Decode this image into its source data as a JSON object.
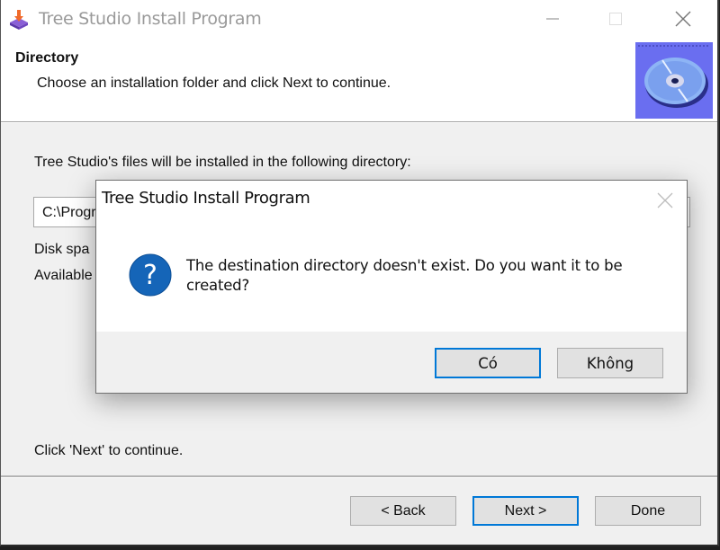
{
  "window": {
    "title": "Tree Studio Install Program",
    "icons": {
      "app": "install-box-icon",
      "minimize": "minimize-icon",
      "maximize": "maximize-icon",
      "close": "close-icon"
    }
  },
  "header": {
    "title": "Directory",
    "subtitle": "Choose an installation folder and click Next to continue.",
    "image": "cd-disc-icon"
  },
  "content": {
    "install_label": "Tree Studio's files will be installed in the following directory:",
    "path_value": "C:\\Progr",
    "disk_space_label": "Disk spa",
    "available_label": "Available",
    "continue_hint": "Click 'Next' to continue."
  },
  "footer": {
    "back_label": "< Back",
    "next_label": "Next >",
    "done_label": "Done"
  },
  "dialog": {
    "title": "Tree Studio Install Program",
    "icon": "question-icon",
    "message": "The destination directory doesn't exist. Do you want it to be created?",
    "yes_label": "Có",
    "no_label": "Không"
  },
  "colors": {
    "accent": "#0078d7",
    "question_icon": "#1565b8",
    "cd_background": "#6a6ef0"
  }
}
